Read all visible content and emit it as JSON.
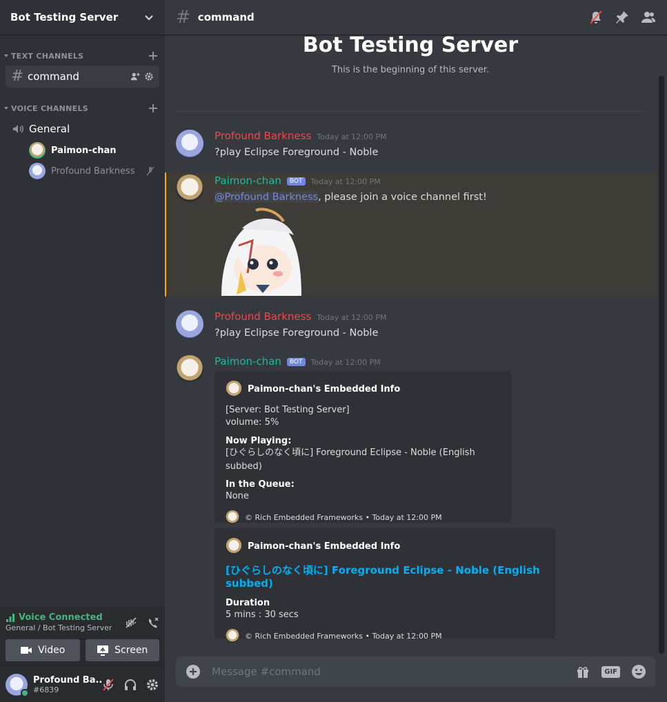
{
  "server": {
    "name": "Bot Testing Server"
  },
  "sidebar": {
    "text_category": "TEXT CHANNELS",
    "voice_category": "VOICE CHANNELS",
    "text_channels": [
      {
        "name": "command"
      }
    ],
    "voice_channels": [
      {
        "name": "General",
        "users": [
          {
            "name": "Paimon-chan"
          },
          {
            "name": "Profound Barkness"
          }
        ]
      }
    ]
  },
  "voice_panel": {
    "status": "Voice Connected",
    "location": "General / Bot Testing Server",
    "video_label": "Video",
    "screen_label": "Screen"
  },
  "user_panel": {
    "name": "Profound Ba...",
    "tag": "#6839"
  },
  "channel": {
    "name": "command"
  },
  "welcome": {
    "title": "Bot Testing Server",
    "subtitle": "This is the beginning of this server."
  },
  "messages": [
    {
      "author": "Profound Barkness",
      "color": "#f04747",
      "time": "Today at 12:00 PM",
      "text": "?play Eclipse Foreground - Noble"
    },
    {
      "author": "Paimon-chan",
      "color": "#1abc9c",
      "bot": "BOT",
      "time": "Today at 12:00 PM",
      "mention": "@Profound Barkness",
      "text": ", please join a voice channel first!"
    },
    {
      "author": "Profound Barkness",
      "color": "#f04747",
      "time": "Today at 12:00 PM",
      "text": "?play Eclipse Foreground - Noble"
    },
    {
      "author": "Paimon-chan",
      "color": "#1abc9c",
      "bot": "BOT",
      "time": "Today at 12:00 PM"
    }
  ],
  "embed1": {
    "author": "Paimon-chan's Embedded Info",
    "desc_line1": "[Server: Bot Testing Server]",
    "desc_line2": "volume: 5%",
    "field1_name": "Now Playing:",
    "field1_value": "[ひぐらしのなく頃に] Foreground Eclipse - Noble (English subbed)",
    "field2_name": "In the Queue:",
    "field2_value": "None",
    "footer": "© Rich Embedded Frameworks • Today at 12:00 PM"
  },
  "embed2": {
    "author": "Paimon-chan's Embedded Info",
    "title": "[ひぐらしのなく頃に] Foreground Eclipse - Noble (English subbed)",
    "field_name": "Duration",
    "field_value": "5 mins : 30 secs",
    "footer": "© Rich Embedded Frameworks • Today at 12:00 PM"
  },
  "composer": {
    "placeholder": "Message #command",
    "gif_label": "GIF"
  }
}
